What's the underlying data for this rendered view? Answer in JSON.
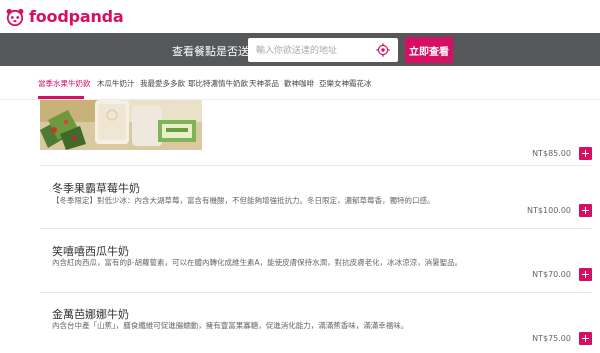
{
  "brand": {
    "name": "foodpanda",
    "color": "#d70f64",
    "logo_icon": "panda-logo-icon"
  },
  "search": {
    "label": "查看餐點是否送到",
    "placeholder": "輸入你欲送達的地址",
    "button_label": "立即查看",
    "locate_icon": "locate-target-icon"
  },
  "categories": [
    {
      "label": "當季水果牛奶飲",
      "active": true
    },
    {
      "label": "木瓜牛奶汁",
      "active": false
    },
    {
      "label": "我最愛多多飲",
      "active": false
    },
    {
      "label": "耶比特濃情牛奶飲",
      "active": false
    },
    {
      "label": "天神茶品",
      "active": false
    },
    {
      "label": "歡神咖啡",
      "active": false
    },
    {
      "label": "亞樂女神霜花冰",
      "active": false
    }
  ],
  "menu": {
    "first_item_price": "NT$85.00",
    "items": [
      {
        "name": "冬季果霸草莓牛奶",
        "description": "【冬季限定】對低少冰：內含大湖草莓，富含有機酸，不但能夠增強抵抗力。冬日限定，濃郁草莓香，獨特的口感。",
        "price": "NT$100.00"
      },
      {
        "name": "笑嘻嘻西瓜牛奶",
        "description": "內含紅肉西瓜，富有的β-胡蘿蔔素，可以在體內轉化成維生素A，能使皮膚保持水潤，對抗皮膚老化，冰冰涼涼，消暑聖品。",
        "price": "NT$70.00"
      },
      {
        "name": "金萬芭娜娜牛奶",
        "description": "內含台中產「山蕉」，膳食纖維可促進腸蠕動，擁有豐富果寡糖，促進消化能力，滿滿蕉香味，滿滿幸福味。",
        "price": "NT$75.00"
      }
    ]
  },
  "icons": {
    "add": "plus-icon"
  }
}
